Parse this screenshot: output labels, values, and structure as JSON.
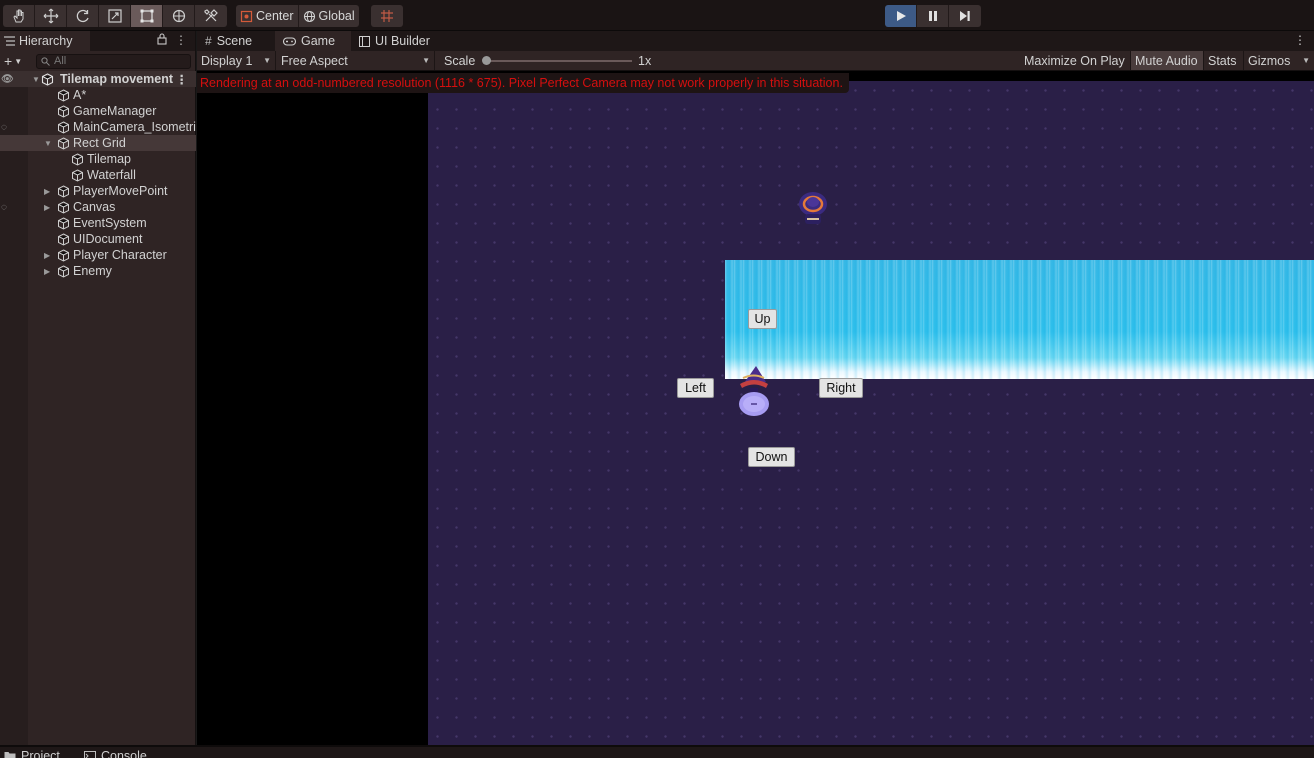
{
  "toolbar": {
    "tools": [
      "hand-tool",
      "move-tool",
      "rotate-tool",
      "scale-tool",
      "rect-tool",
      "transform-tool",
      "custom-tools"
    ],
    "active_tool": "rect-tool",
    "pivot_label": "Center",
    "space_label": "Global",
    "play_state": "playing"
  },
  "hierarchy": {
    "tab_label": "Hierarchy",
    "search_placeholder": "All",
    "scene_name": "Tilemap movement",
    "items": [
      {
        "label": "A*"
      },
      {
        "label": "GameManager"
      },
      {
        "label": "MainCamera_Isometri"
      },
      {
        "label": "Rect Grid"
      },
      {
        "label": "Tilemap"
      },
      {
        "label": "Waterfall"
      },
      {
        "label": "PlayerMovePoint"
      },
      {
        "label": "Canvas"
      },
      {
        "label": "EventSystem"
      },
      {
        "label": "UIDocument"
      },
      {
        "label": "Player Character"
      },
      {
        "label": "Enemy"
      }
    ]
  },
  "game_view": {
    "tabs": [
      {
        "label": "Scene"
      },
      {
        "label": "Game"
      },
      {
        "label": "UI Builder"
      }
    ],
    "display": "Display 1",
    "aspect": "Free Aspect",
    "scale_label": "Scale",
    "scale_value": "1x",
    "maximize_label": "Maximize On Play",
    "mute_label": "Mute Audio",
    "stats_label": "Stats",
    "gizmos_label": "Gizmos",
    "warning": "Rendering at an odd-numbered resolution (1116 * 675). Pixel Perfect Camera may not work properly in this situation.",
    "buttons": {
      "up": "Up",
      "left": "Left",
      "right": "Right",
      "down": "Down"
    }
  },
  "bottom_tabs": [
    {
      "label": "Project"
    },
    {
      "label": "Console"
    }
  ],
  "colors": {
    "play_active": "#3d5a86",
    "warning_text": "#d40f0f",
    "world_bg": "#2a1f47",
    "waterfall": "#2fc0ec"
  }
}
